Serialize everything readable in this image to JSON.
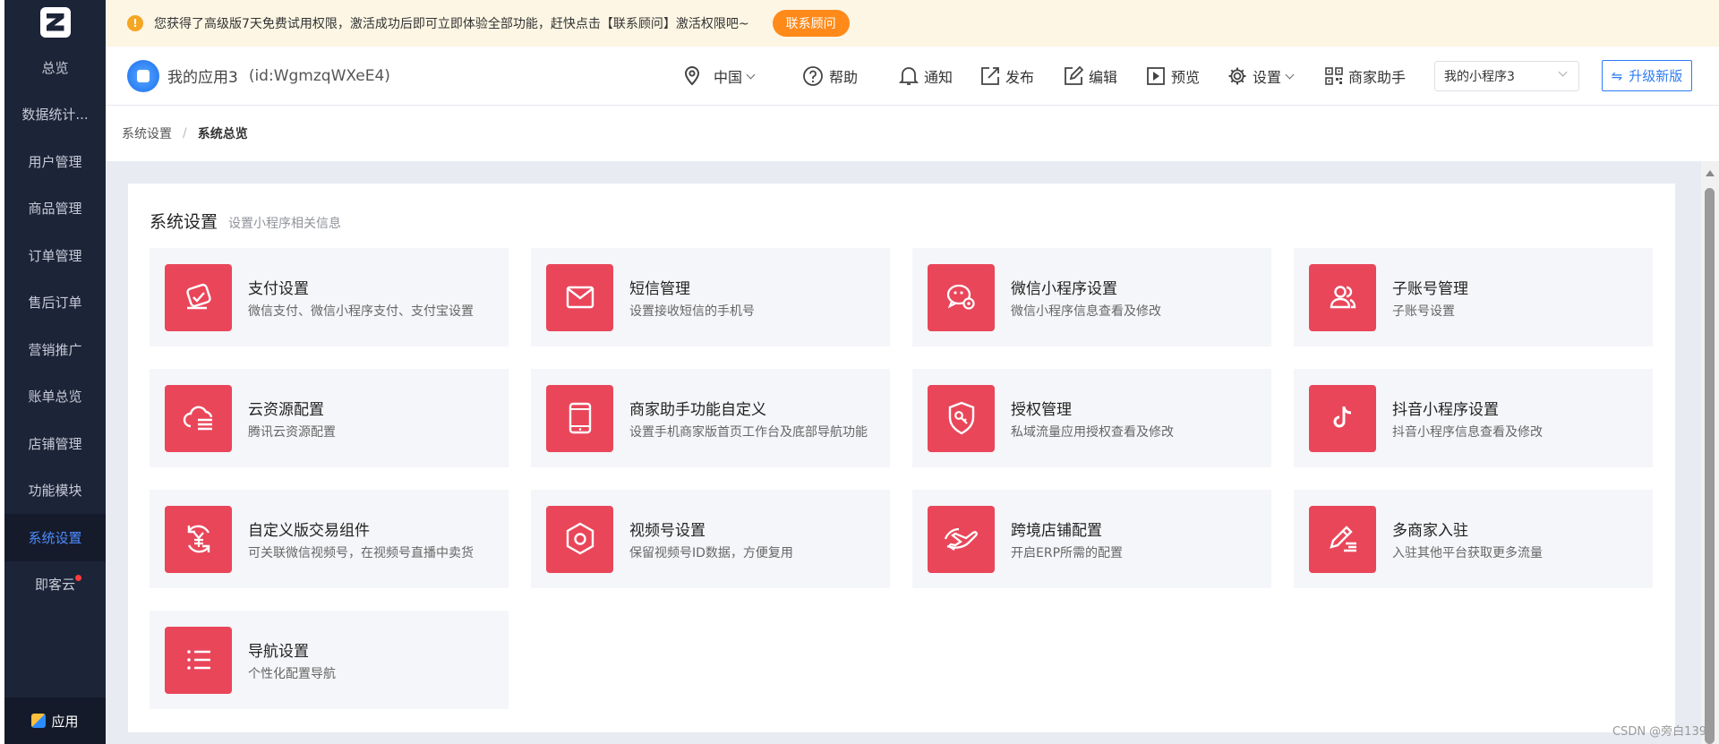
{
  "sidebar": {
    "logo_icon": "brand-logo-icon",
    "items": [
      {
        "label": "总览"
      },
      {
        "label": "数据统计..."
      },
      {
        "label": "用户管理"
      },
      {
        "label": "商品管理"
      },
      {
        "label": "订单管理"
      },
      {
        "label": "售后订单"
      },
      {
        "label": "营销推广"
      },
      {
        "label": "账单总览"
      },
      {
        "label": "店铺管理"
      },
      {
        "label": "功能模块"
      },
      {
        "label": "系统设置",
        "active": true
      },
      {
        "label": "即客云",
        "badge_dot": true
      }
    ],
    "bottom_label": "应用"
  },
  "notice": {
    "text": "您获得了高级版7天免费试用权限，激活成功后即可立即体验全部功能，赶快点击【联系顾问】激活权限吧~",
    "button": "联系顾问"
  },
  "header": {
    "app_name": "我的应用3",
    "app_id": "(id:WgmzqWXeE4)",
    "region": "中国",
    "tools": {
      "help": "帮助",
      "notify": "通知",
      "publish": "发布",
      "edit": "编辑",
      "preview": "预览",
      "settings": "设置",
      "merchant_helper": "商家助手"
    },
    "mini_program_select": "我的小程序3",
    "upgrade": "升级新版"
  },
  "breadcrumb": {
    "parent": "系统设置",
    "current": "系统总览"
  },
  "panel": {
    "title": "系统设置",
    "subtitle": "设置小程序相关信息",
    "cards": [
      {
        "title": "支付设置",
        "desc": "微信支付、微信小程序支付、支付宝设置",
        "icon": "payment-icon"
      },
      {
        "title": "短信管理",
        "desc": "设置接收短信的手机号",
        "icon": "mail-icon"
      },
      {
        "title": "微信小程序设置",
        "desc": "微信小程序信息查看及修改",
        "icon": "wechat-settings-icon"
      },
      {
        "title": "子账号管理",
        "desc": "子账号设置",
        "icon": "users-icon"
      },
      {
        "title": "云资源配置",
        "desc": "腾讯云资源配置",
        "icon": "cloud-icon"
      },
      {
        "title": "商家助手功能自定义",
        "desc": "设置手机商家版首页工作台及底部导航功能",
        "icon": "tablet-icon"
      },
      {
        "title": "授权管理",
        "desc": "私域流量应用授权查看及修改",
        "icon": "shield-key-icon"
      },
      {
        "title": "抖音小程序设置",
        "desc": "抖音小程序信息查看及修改",
        "icon": "tiktok-icon"
      },
      {
        "title": "自定义版交易组件",
        "desc": "可关联微信视频号，在视频号直播中卖货",
        "icon": "yuan-cycle-icon"
      },
      {
        "title": "视频号设置",
        "desc": "保留视频号ID数据，方便复用",
        "icon": "hexagon-icon"
      },
      {
        "title": "跨境店铺配置",
        "desc": "开启ERP所需的配置",
        "icon": "plane-icon"
      },
      {
        "title": "多商家入驻",
        "desc": "入驻其他平台获取更多流量",
        "icon": "pen-list-icon"
      },
      {
        "title": "导航设置",
        "desc": "个性化配置导航",
        "icon": "list-icon"
      }
    ]
  },
  "watermark": "CSDN @旁白139",
  "colors": {
    "sidebar_bg": "#1c2438",
    "accent_blue": "#2d7cf5",
    "card_icon_bg": "#e9465a",
    "notice_bg": "#fdf6e4",
    "notice_button": "#ff8a1a"
  }
}
